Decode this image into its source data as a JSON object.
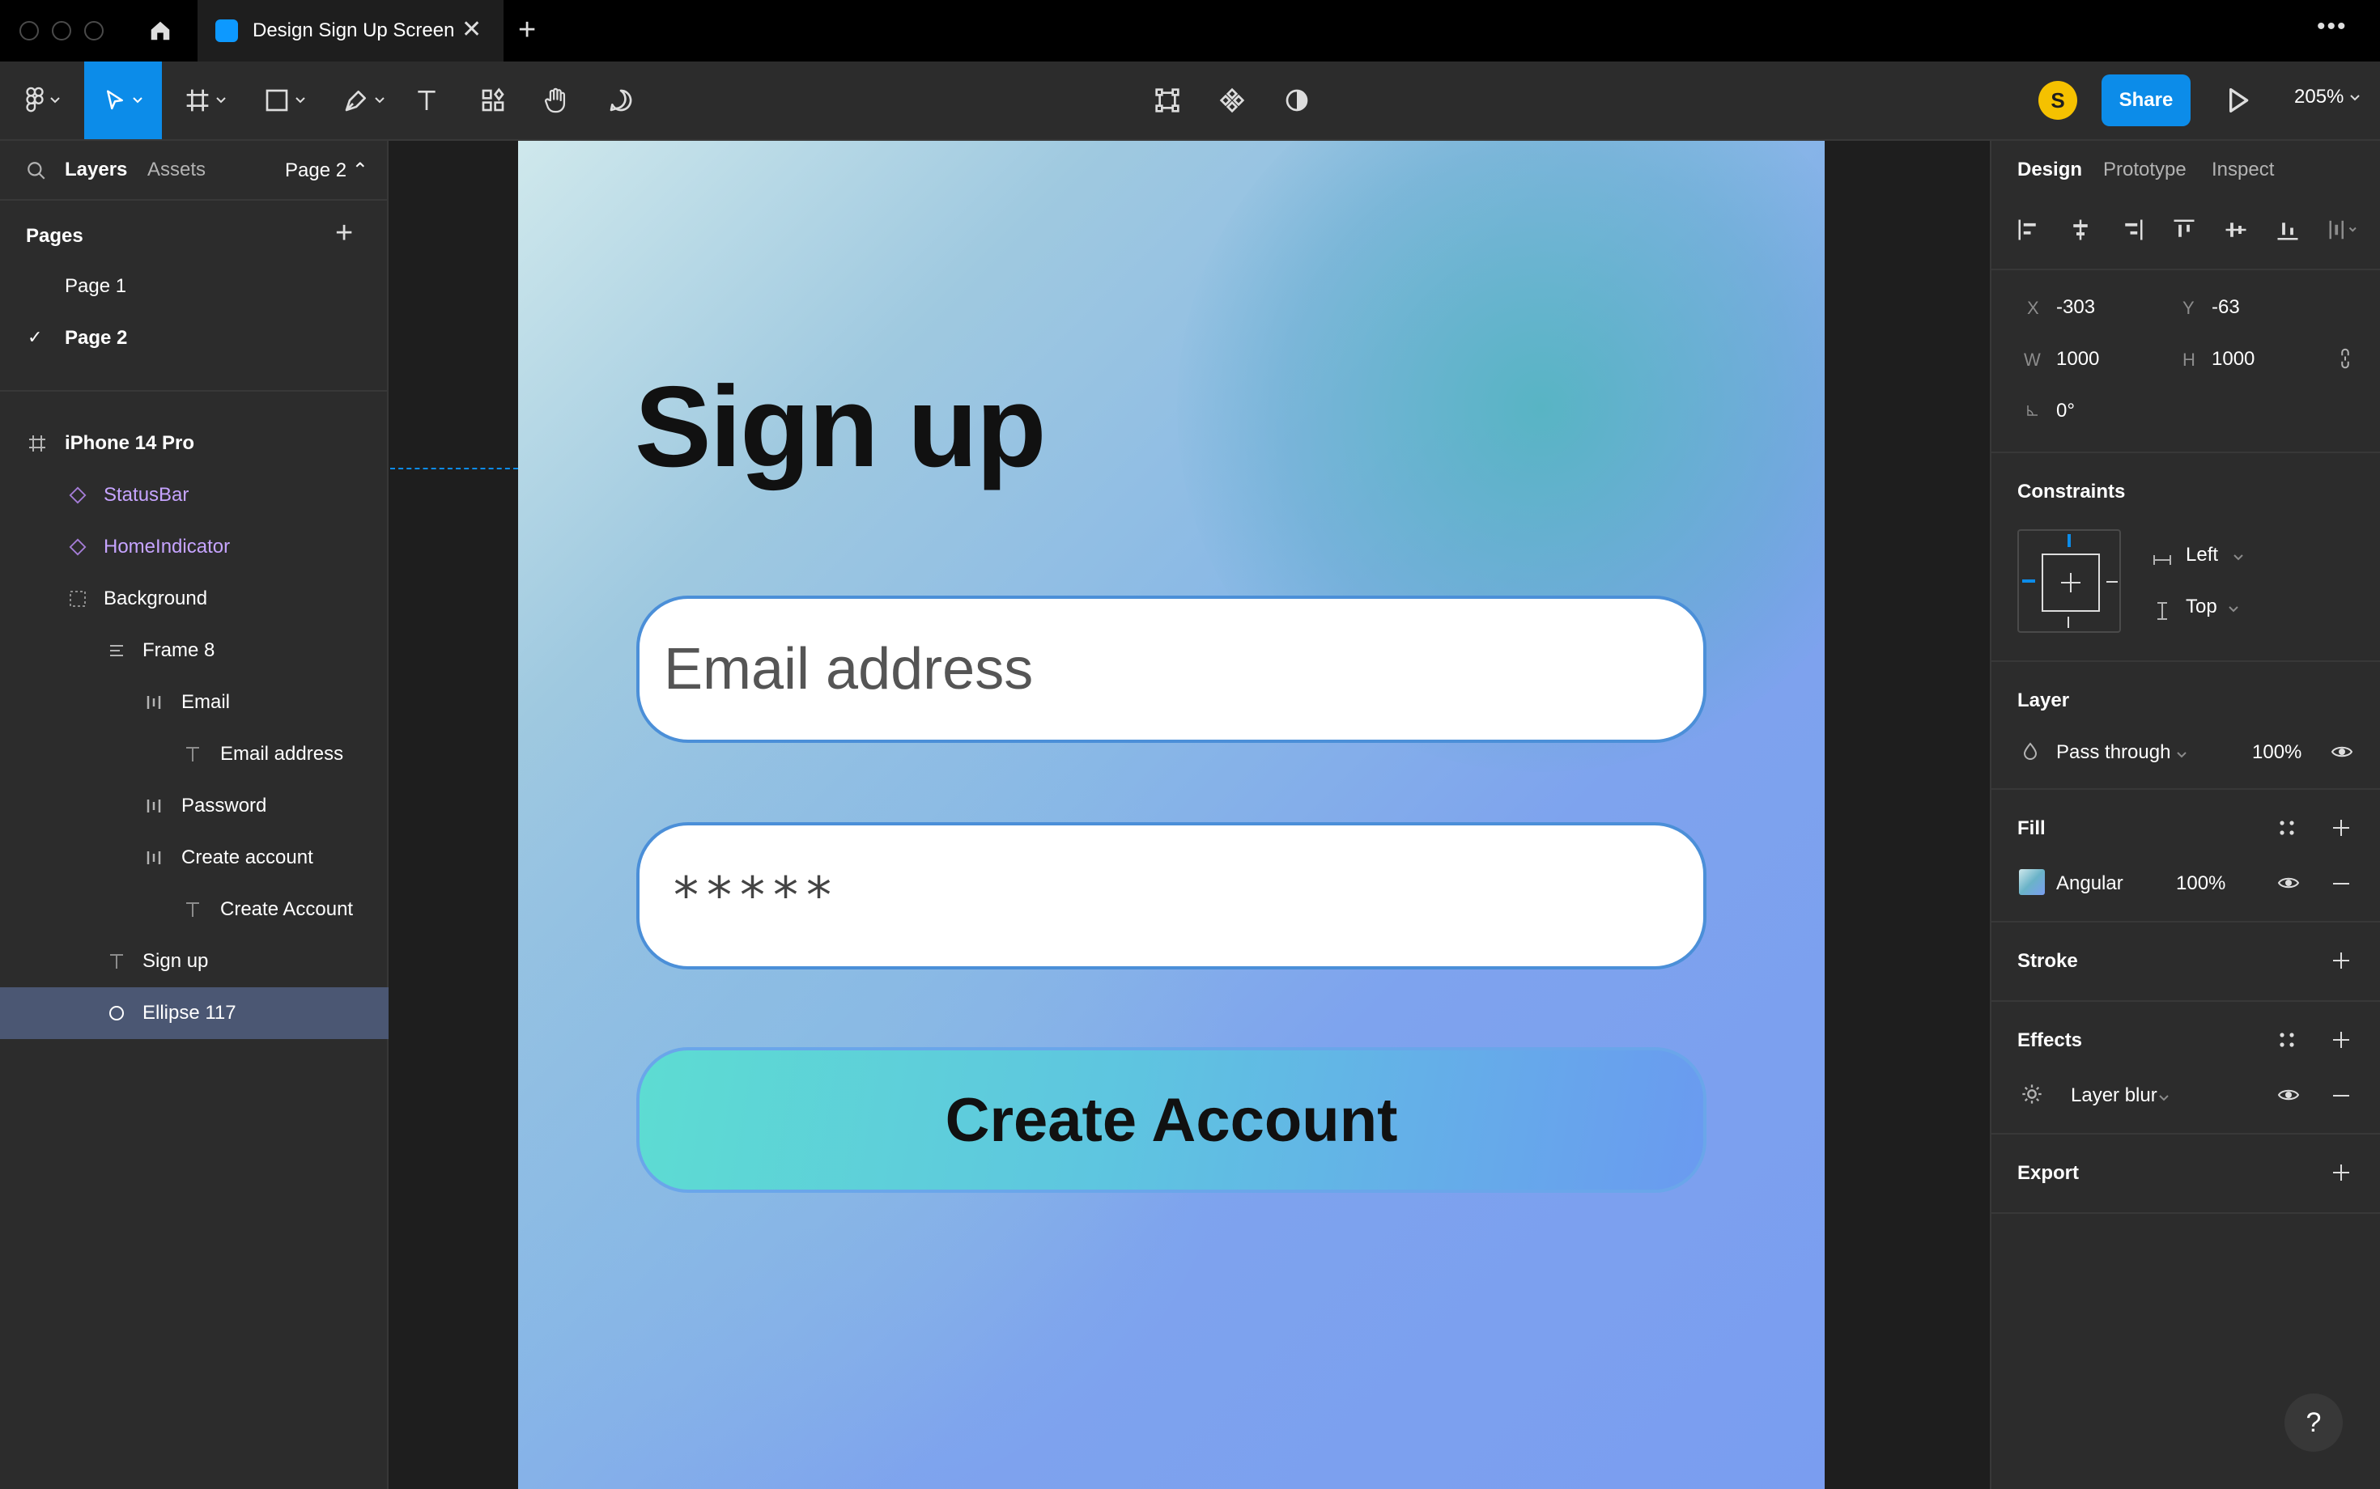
{
  "titlebar": {
    "tab_title": "Design Sign Up Screen",
    "close_glyph": "✕",
    "new_tab_glyph": "+",
    "more_glyph": "•••"
  },
  "toolbar": {
    "avatar_initial": "S",
    "share_label": "Share",
    "zoom_label": "205%",
    "accent": "#0c8ce9"
  },
  "left_panel": {
    "tabs": {
      "layers": "Layers",
      "assets": "Assets"
    },
    "page_selector": "Page 2 ⌃",
    "pages_title": "Pages",
    "pages_add": "+",
    "pages": [
      {
        "label": "Page 1",
        "active": false
      },
      {
        "label": "Page 2",
        "active": true,
        "check": "✓"
      }
    ],
    "layers": [
      {
        "label": "iPhone 14 Pro",
        "icon": "frame-hash-icon"
      },
      {
        "label": "StatusBar",
        "icon": "component-instance-icon"
      },
      {
        "label": "HomeIndicator",
        "icon": "component-instance-icon"
      },
      {
        "label": "Background",
        "icon": "dashed-frame-icon"
      },
      {
        "label": "Frame 8",
        "icon": "auto-layout-vertical-icon"
      },
      {
        "label": "Email",
        "icon": "auto-layout-horizontal-icon"
      },
      {
        "label": "Email address",
        "icon": "text-layer-icon"
      },
      {
        "label": "Password",
        "icon": "auto-layout-horizontal-icon"
      },
      {
        "label": "Create account",
        "icon": "auto-layout-horizontal-icon"
      },
      {
        "label": "Create Account",
        "icon": "text-layer-icon"
      },
      {
        "label": "Sign up",
        "icon": "text-layer-icon"
      },
      {
        "label": "Ellipse 117",
        "icon": "ellipse-icon",
        "selected": true
      }
    ]
  },
  "canvas": {
    "title": "Sign up",
    "email_placeholder": "Email address",
    "password_value": "*****",
    "button_label": "Create Account"
  },
  "right_panel": {
    "tabs": {
      "design": "Design",
      "prototype": "Prototype",
      "inspect": "Inspect"
    },
    "x_label": "X",
    "x_value": "-303",
    "y_label": "Y",
    "y_value": "-63",
    "w_label": "W",
    "w_value": "1000",
    "h_label": "H",
    "h_value": "1000",
    "rotation": "0°",
    "constraints_title": "Constraints",
    "constraint_h": "Left",
    "constraint_v": "Top",
    "layer_title": "Layer",
    "blend_mode": "Pass through",
    "layer_opacity": "100%",
    "fill_title": "Fill",
    "fill_type": "Angular",
    "fill_opacity": "100%",
    "stroke_title": "Stroke",
    "effects_title": "Effects",
    "effect_type": "Layer blur",
    "export_title": "Export",
    "help_glyph": "?"
  }
}
